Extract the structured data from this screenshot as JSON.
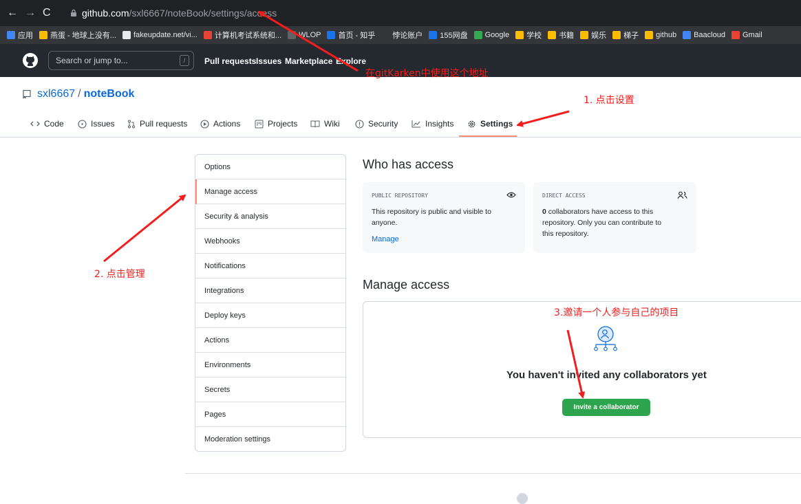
{
  "browser": {
    "url_host": "github.com",
    "url_path": "/sxl6667/noteBook/settings/access",
    "bookmarks": [
      {
        "label": "应用",
        "color": "#4285f4"
      },
      {
        "label": "燕蛋 - 地球上没有...",
        "color": "#fbbc04"
      },
      {
        "label": "fakeupdate.net/vi...",
        "color": "#e8eaed"
      },
      {
        "label": "计算机考试系统和...",
        "color": "#ea4335"
      },
      {
        "label": "WLOP",
        "color": "#5f6368"
      },
      {
        "label": "首页 - 知乎",
        "color": "#1a73e8"
      },
      {
        "label": "悖论账户",
        "color": "#35363a"
      },
      {
        "label": "155网盘",
        "color": "#1a73e8"
      },
      {
        "label": "Google",
        "color": "#34a853"
      },
      {
        "label": "学校",
        "color": "#fbbc04"
      },
      {
        "label": "书籍",
        "color": "#fbbc04"
      },
      {
        "label": "娱乐",
        "color": "#fbbc04"
      },
      {
        "label": "梯子",
        "color": "#fbbc04"
      },
      {
        "label": "github",
        "color": "#fbbc04"
      },
      {
        "label": "Baacloud",
        "color": "#4285f4"
      },
      {
        "label": "Gmail",
        "color": "#ea4335"
      }
    ]
  },
  "github_header": {
    "search_placeholder": "Search or jump to...",
    "search_key": "/",
    "nav": [
      "Pull requests",
      "Issues",
      "Marketplace",
      "Explore"
    ]
  },
  "repo": {
    "owner": "sxl6667",
    "separator": "/",
    "name": "noteBook",
    "tabs": [
      "Code",
      "Issues",
      "Pull requests",
      "Actions",
      "Projects",
      "Wiki",
      "Security",
      "Insights",
      "Settings"
    ],
    "active_tab": "Settings"
  },
  "settings_menu": {
    "items": [
      "Options",
      "Manage access",
      "Security & analysis",
      "Webhooks",
      "Notifications",
      "Integrations",
      "Deploy keys",
      "Actions",
      "Environments",
      "Secrets",
      "Pages",
      "Moderation settings"
    ],
    "active": "Manage access"
  },
  "who_has_access": {
    "title": "Who has access",
    "public": {
      "heading": "PUBLIC REPOSITORY",
      "text": "This repository is public and visible to anyone.",
      "link": "Manage"
    },
    "direct": {
      "heading": "DIRECT ACCESS",
      "count": "0",
      "text": " collaborators have access to this repository. Only you can contribute to this repository."
    }
  },
  "manage_access": {
    "title": "Manage access",
    "empty_text": "You haven't invited any collaborators yet",
    "invite_button": "Invite a collaborator"
  },
  "annotations": {
    "note1": "在gitKarken中使用这个地址",
    "note2": "1. 点击设置",
    "note3": "2. 点击管理",
    "note4": "3.邀请一个人参与自己的项目",
    "color": "#f21e1e"
  },
  "colors": {
    "accent_link": "#0969da",
    "active_underline": "#fd8c73",
    "invite_green": "#2da44e",
    "gh_header": "#24292f"
  }
}
